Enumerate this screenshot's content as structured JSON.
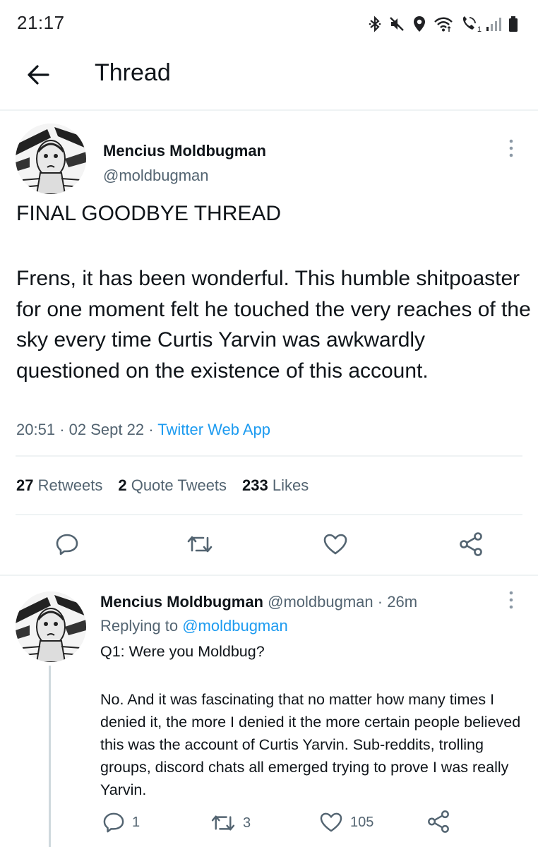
{
  "status_bar": {
    "time": "21:17",
    "icons": [
      "bluetooth-icon",
      "mute-icon",
      "location-icon",
      "wifi-icon",
      "call-icon",
      "signal-icon",
      "battery-icon"
    ],
    "call_badge": "1"
  },
  "header": {
    "title": "Thread"
  },
  "main_tweet": {
    "name": "Mencius Moldbugman",
    "handle": "@moldbugman",
    "title": "FINAL GOODBYE THREAD",
    "body": "Frens, it has been wonderful. This humble shitpoaster for one moment felt he touched the very reaches of the sky every time Curtis Yarvin was awkwardly questioned on the existence of this account.",
    "time": "20:51",
    "date": "02 Sept 22",
    "source": "Twitter Web App",
    "retweets_count": "27",
    "retweets_label": "Retweets",
    "quotes_count": "2",
    "quotes_label": "Quote Tweets",
    "likes_count": "233",
    "likes_label": "Likes"
  },
  "reply_tweet": {
    "name": "Mencius Moldbugman",
    "handle": "@moldbugman",
    "age": "26m",
    "replying_prefix": "Replying to",
    "replying_to": "@moldbugman",
    "line1": "Q1: Were you Moldbug?",
    "line2": "No. And it was fascinating that no matter how many times I denied it, the more I denied it the more certain people believed this was the account of Curtis Yarvin. Sub-reddits, trolling groups, discord chats all emerged trying to prove I was really Yarvin.",
    "reply_count": "1",
    "retweet_count": "3",
    "like_count": "105"
  },
  "colors": {
    "text": "#0f1419",
    "secondary": "#536471",
    "link": "#1d9bf0",
    "divider": "#eff3f4"
  }
}
